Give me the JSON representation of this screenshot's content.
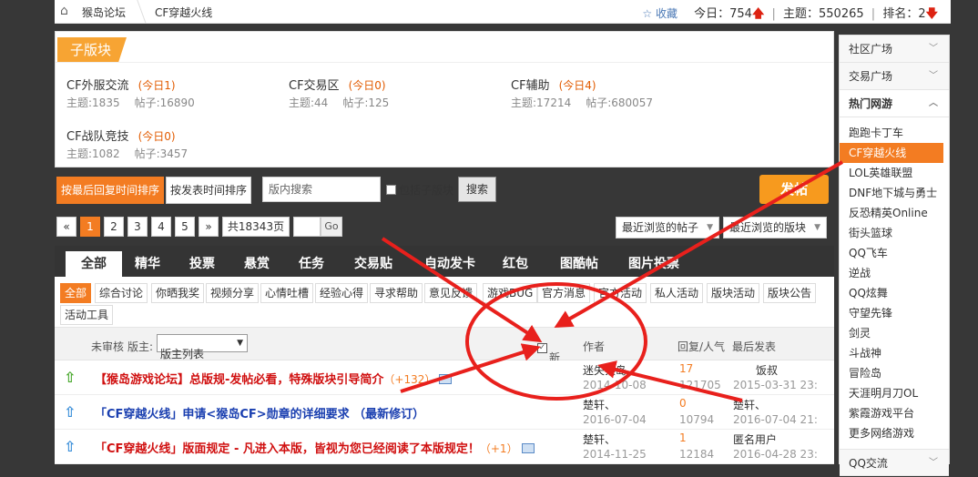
{
  "breadcrumb": {
    "home": "猴岛论坛",
    "current": "CF穿越火线"
  },
  "stats": {
    "favorite": "收藏",
    "today_label": "今日：",
    "today_value": "754",
    "topics_label": "主题：",
    "topics_value": "550265",
    "rank_label": "排名：",
    "rank_value": "2",
    "separator": "|"
  },
  "subforums": {
    "title": "子版块",
    "items": [
      {
        "name": "CF外服交流",
        "today": "(今日1)",
        "topics": "主题:1835",
        "posts": "帖子:16890"
      },
      {
        "name": "CF交易区",
        "today": "(今日0)",
        "topics": "主题:44",
        "posts": "帖子:125"
      },
      {
        "name": "CF辅助",
        "today": "(今日4)",
        "topics": "主题:17214",
        "posts": "帖子:680057"
      },
      {
        "name": "CF战队竞技",
        "today": "(今日0)",
        "topics": "主题:1082",
        "posts": "帖子:3457"
      }
    ]
  },
  "toolbar": {
    "sort_reply": "按最后回复时间排序",
    "sort_post": "按发表时间排序",
    "search_placeholder": "版内搜索",
    "include_sub": "包括子版块",
    "search_btn": "搜索",
    "post_btn": "发帖"
  },
  "pager": {
    "prev": "«",
    "pages": [
      "1",
      "2",
      "3",
      "4",
      "5"
    ],
    "next": "»",
    "total": "共18343页",
    "go": "Go"
  },
  "dropdowns": {
    "recent_posts": "最近浏览的帖子",
    "recent_boards": "最近浏览的版块"
  },
  "tabs": [
    "全部",
    "精华",
    "投票",
    "悬赏",
    "任务",
    "交易贴",
    "自动发卡",
    "红包",
    "图酷帖",
    "图片投票"
  ],
  "categories": [
    "全部",
    "综合讨论",
    "你晒我奖",
    "视频分享",
    "心情吐槽",
    "经验心得",
    "寻求帮助",
    "意见反馈",
    "游戏BUG",
    "官方消息",
    "官方活动",
    "私人活动",
    "版块活动",
    "版块公告",
    "活动工具"
  ],
  "thead": {
    "unreviewed": "未审核",
    "moderator": "版主:",
    "moderator_select": "版主列表",
    "newwin": "新窗",
    "author": "作者",
    "reply_views": "回复/人气",
    "last_post": "最后发表"
  },
  "threads": [
    {
      "icon": "pin-green",
      "title": "【猴岛游戏论坛】总版规-发帖必看，特殊版块引导简介",
      "plus": "（+132）",
      "author": "迷失猴岛",
      "date": "2014-10-08",
      "replies": "17",
      "views": "121705",
      "last_user": "饭叔",
      "last_date": "2015-03-31 23:",
      "color": "#d01010"
    },
    {
      "icon": "pin-blue",
      "title": "「CF穿越火线」申请<猴岛CF>勋章的详细要求 （最新修订）",
      "plus": "",
      "author": "楚轩、",
      "date": "2016-07-04",
      "replies": "0",
      "views": "10794",
      "last_user": "楚轩、",
      "last_date": "2016-07-04 21:",
      "color": "#1a3fb0"
    },
    {
      "icon": "pin-blue",
      "title": "「CF穿越火线」版面规定 - 凡进入本版，皆视为您已经阅读了本版规定！",
      "plus": "（+1）",
      "author": "楚轩、",
      "date": "2014-11-25",
      "replies": "1",
      "views": "12184",
      "last_user": "匿名用户",
      "last_date": "2016-04-28 23:",
      "color": "#d01010"
    }
  ],
  "sidebar": {
    "groups": [
      "社区广场",
      "交易广场",
      "热门网游"
    ],
    "games": [
      "跑跑卡丁车",
      "CF穿越火线",
      "LOL英雄联盟",
      "DNF地下城与勇士",
      "反恐精英Online",
      "街头篮球",
      "QQ飞车",
      "逆战",
      "QQ炫舞",
      "守望先锋",
      "剑灵",
      "斗战神",
      "冒险岛",
      "天涯明月刀OL",
      "紫霞游戏平台",
      "更多网络游戏"
    ],
    "last_group": "QQ交流"
  },
  "colors": {
    "accent": "#f37c22",
    "annotation": "#e8201c"
  }
}
